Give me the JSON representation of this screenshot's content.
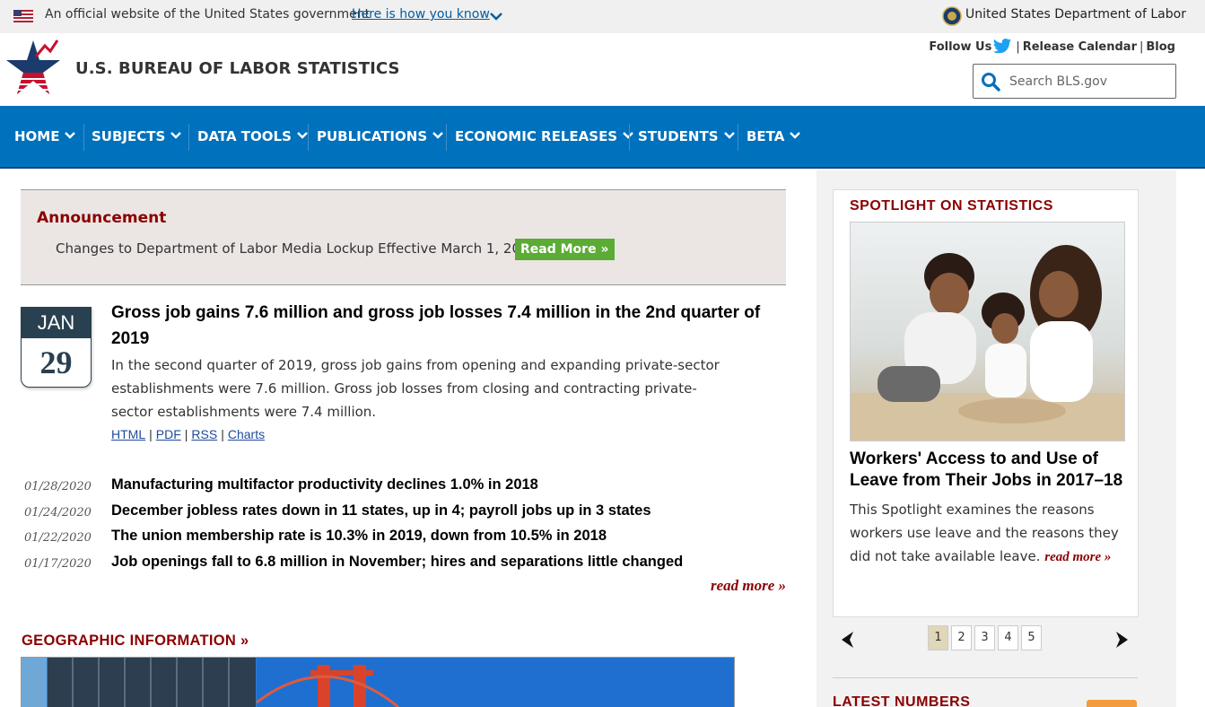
{
  "gov_banner": {
    "official_text": "An official website of the United States government",
    "how_you_know": "Here is how you know",
    "department": "United States Department of Labor"
  },
  "header": {
    "site_title": "U.S. BUREAU OF LABOR STATISTICS",
    "follow_us": "Follow Us",
    "release_calendar": "Release Calendar",
    "blog": "Blog",
    "search_placeholder": "Search BLS.gov"
  },
  "nav": {
    "items": [
      {
        "label": "HOME"
      },
      {
        "label": "SUBJECTS"
      },
      {
        "label": "DATA TOOLS"
      },
      {
        "label": "PUBLICATIONS"
      },
      {
        "label": "ECONOMIC RELEASES"
      },
      {
        "label": "STUDENTS"
      },
      {
        "label": "BETA"
      }
    ]
  },
  "announcement": {
    "heading": "Announcement",
    "text": "Changes to Department of Labor Media Lockup Effective March 1, 2020",
    "button": "Read More »"
  },
  "featured": {
    "month": "JAN",
    "day": "29",
    "headline": "Gross job gains 7.6 million and gross job losses 7.4 million in the 2nd quarter of 2019",
    "summary": "In the second quarter of 2019, gross job gains from opening and expanding private-sector establishments were 7.6 million. Gross job losses from closing and contracting private-sector establishments were 7.4 million.",
    "links": [
      "HTML",
      "PDF",
      "RSS",
      "Charts"
    ]
  },
  "news": [
    {
      "date": "01/28/2020",
      "title": "Manufacturing multifactor productivity declines 1.0% in 2018"
    },
    {
      "date": "01/24/2020",
      "title": "December jobless rates down in 11 states, up in 4; payroll jobs up in 3 states"
    },
    {
      "date": "01/22/2020",
      "title": "The union membership rate is 10.3% in 2019, down from 10.5% in 2018"
    },
    {
      "date": "01/17/2020",
      "title": "Job openings fall to 6.8 million in November; hires and separations little changed"
    }
  ],
  "news_read_more": "read more »",
  "geo_title": "GEOGRAPHIC INFORMATION »",
  "spotlight": {
    "label": "SPOTLIGHT ON STATISTICS",
    "title": "Workers' Access to and Use of Leave from Their Jobs in 2017–18",
    "description": "This Spotlight examines the reasons workers use leave and the reasons they did not take available leave.",
    "read_more": "read more »",
    "pages": [
      "1",
      "2",
      "3",
      "4",
      "5"
    ],
    "active_page": "1"
  },
  "latest_numbers": "LATEST NUMBERS",
  "colors": {
    "nav_blue": "#0071bc",
    "accent_red": "#8b0000",
    "button_green": "#5bab35",
    "date_navy": "#294050"
  }
}
